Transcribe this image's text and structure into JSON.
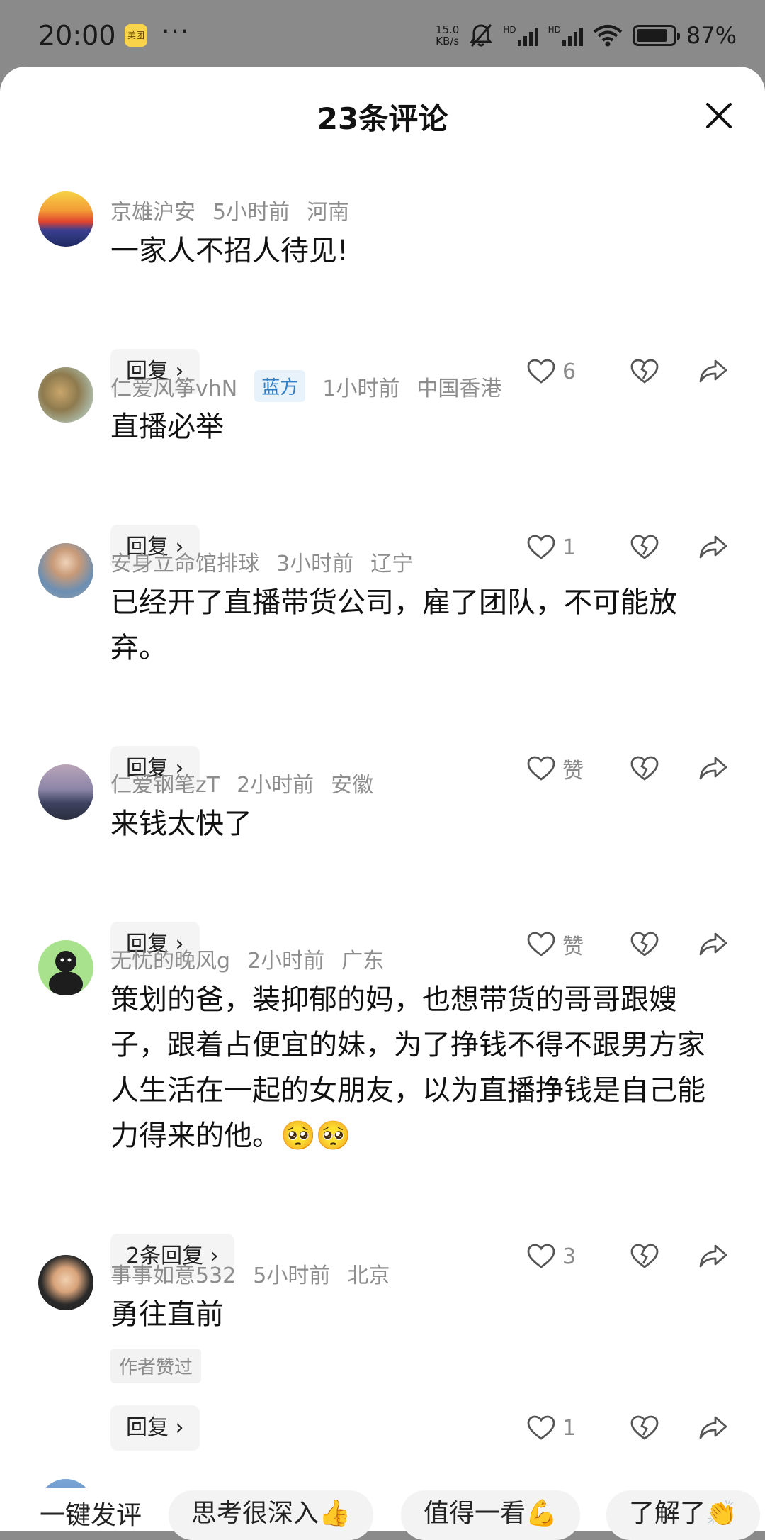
{
  "status_bar": {
    "time": "20:00",
    "app_label": "美团",
    "dots": "···",
    "speed_top": "15.0",
    "speed_bottom": "KB/s",
    "hd1": "HD",
    "hd2": "HD",
    "battery_percent": "87%",
    "battery_level": 0.87
  },
  "sheet": {
    "title": "23条评论"
  },
  "comments": [
    {
      "user": "京雄沪安",
      "time": "5小时前",
      "location": "河南",
      "text": "一家人不招人待见!",
      "reply": "回复",
      "like_count": "6"
    },
    {
      "user": "仁爱风筝vhN",
      "badge": "蓝方",
      "time": "1小时前",
      "location": "中国香港",
      "text": "直播必举",
      "reply": "回复",
      "like_count": "1"
    },
    {
      "user": "安身立命馆排球",
      "time": "3小时前",
      "location": "辽宁",
      "text": "已经开了直播带货公司，雇了团队，不可能放弃。",
      "reply": "回复",
      "like_count": "赞"
    },
    {
      "user": "仁爱钢笔zT",
      "time": "2小时前",
      "location": "安徽",
      "text": "来钱太快了",
      "reply": "回复",
      "like_count": "赞"
    },
    {
      "user": "无忧的晚风g",
      "time": "2小时前",
      "location": "广东",
      "text": "策划的爸，装抑郁的妈，也想带货的哥哥跟嫂子，跟着占便宜的妹，为了挣钱不得不跟男方家人生活在一起的女朋友，以为直播挣钱是自己能力得来的他。🥺🥺",
      "reply": "2条回复",
      "like_count": "3"
    },
    {
      "user": "事事如意532",
      "time": "5小时前",
      "location": "北京",
      "text": "勇往直前",
      "author_liked": "作者赞过",
      "reply": "回复",
      "like_count": "1"
    }
  ],
  "quick_replies": {
    "label": "一键发评",
    "chips": [
      "思考很深入👍",
      "值得一看💪",
      "了解了👏"
    ]
  }
}
